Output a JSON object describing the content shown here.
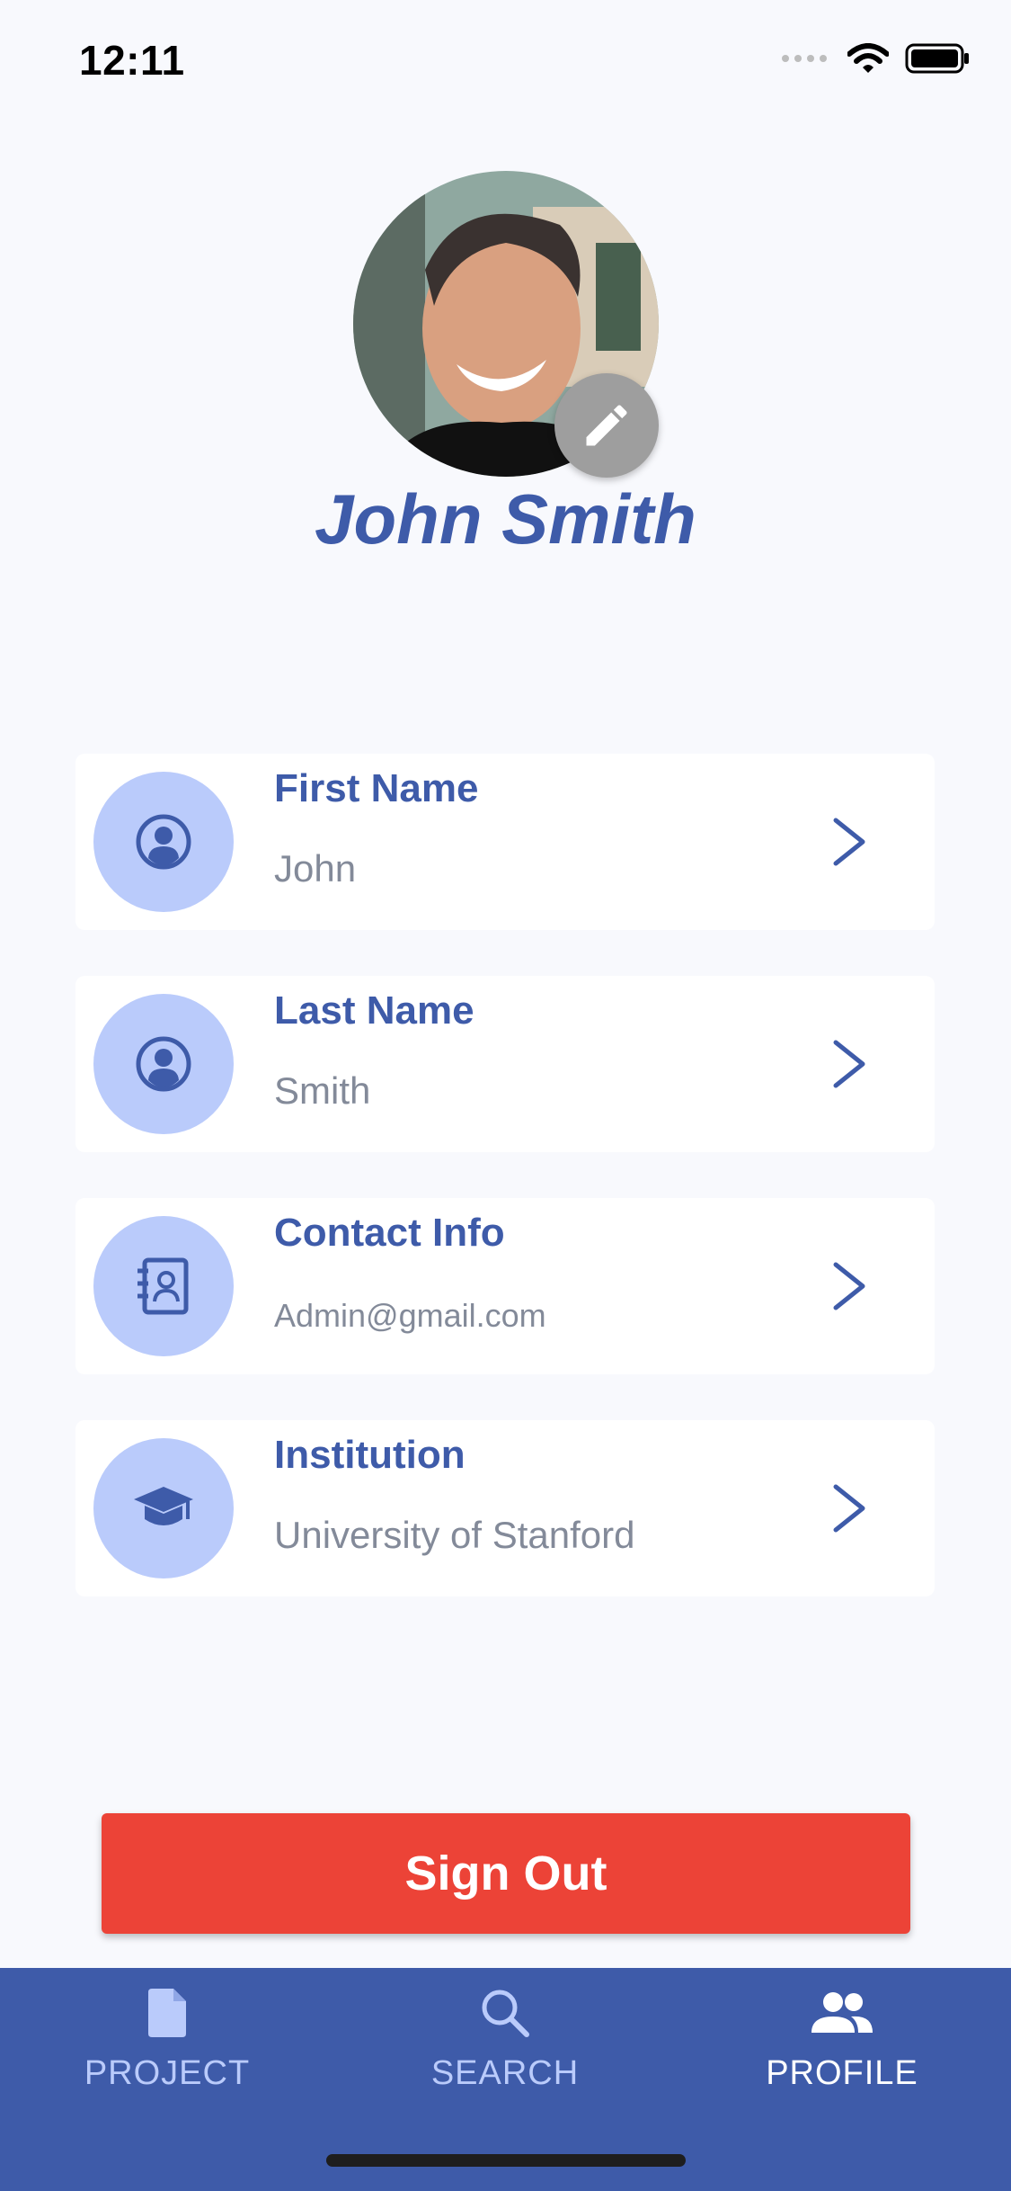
{
  "status_bar": {
    "time": "12:11"
  },
  "profile": {
    "name": "John Smith"
  },
  "fields": [
    {
      "title": "First Name",
      "value": "John",
      "icon": "user-circle-icon"
    },
    {
      "title": "Last Name",
      "value": "Smith",
      "icon": "user-circle-icon"
    },
    {
      "title": "Contact Info",
      "value": "Admin@gmail.com",
      "icon": "contact-book-icon"
    },
    {
      "title": "Institution",
      "value": "University of Stanford",
      "icon": "graduation-cap-icon"
    }
  ],
  "actions": {
    "sign_out": "Sign Out"
  },
  "tabs": [
    {
      "label": "PROJECT",
      "icon": "document-icon",
      "active": false
    },
    {
      "label": "SEARCH",
      "icon": "search-icon",
      "active": false
    },
    {
      "label": "PROFILE",
      "icon": "people-icon",
      "active": true
    }
  ],
  "colors": {
    "accent": "#3E5BA9",
    "icon_circle": "#BACBFB",
    "danger": "#EC4337",
    "background": "#F8F9FD"
  }
}
